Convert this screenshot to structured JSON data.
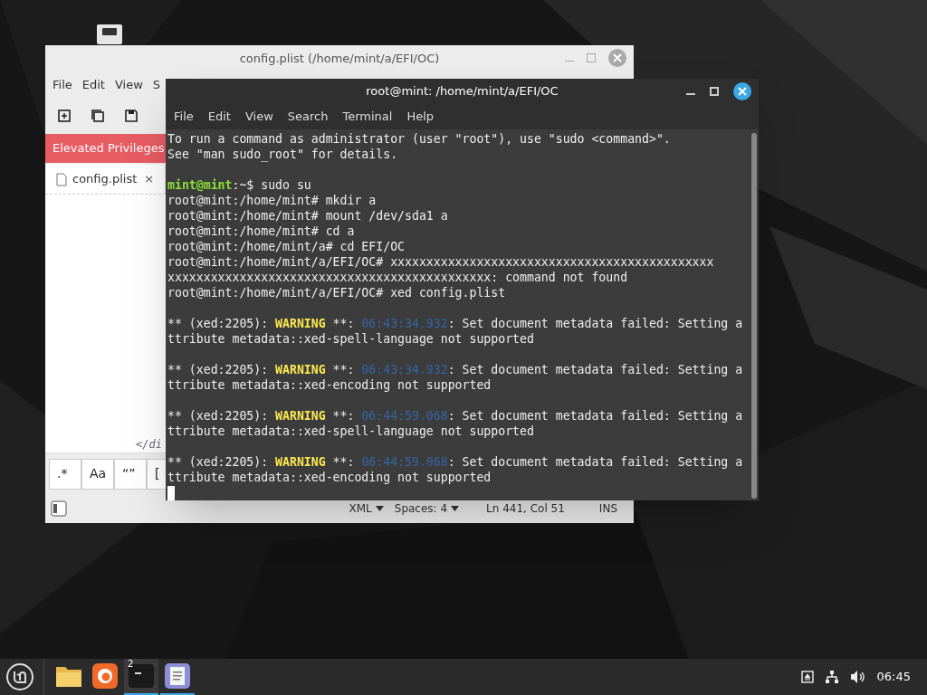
{
  "editor": {
    "title": "config.plist (/home/mint/a/EFI/OC)",
    "menu": [
      "File",
      "Edit",
      "View",
      "S"
    ],
    "infobar": "Elevated Privileges",
    "tab": {
      "label": "config.plist",
      "close": "×"
    },
    "content_fragment": "</di",
    "search_buttons": [
      ".*",
      "Aa",
      "“”",
      "["
    ],
    "status_bar": {
      "language": "XML",
      "spaces": "Spaces: 4",
      "position": "Ln 441, Col 51",
      "mode": "INS"
    }
  },
  "terminal": {
    "title": "root@mint: /home/mint/a/EFI/OC",
    "menu": [
      "File",
      "Edit",
      "View",
      "Search",
      "Terminal",
      "Help"
    ],
    "lines": [
      {
        "kind": "text",
        "text": "To run a command as administrator (user \"root\"), use \"sudo <command>\"."
      },
      {
        "kind": "text",
        "text": "See \"man sudo_root\" for details."
      },
      {
        "kind": "blank"
      },
      {
        "kind": "prompt",
        "user": "mint@mint",
        "rest": ":~$ sudo su"
      },
      {
        "kind": "text",
        "text": "root@mint:/home/mint# mkdir a"
      },
      {
        "kind": "text",
        "text": "root@mint:/home/mint# mount /dev/sda1 a"
      },
      {
        "kind": "text",
        "text": "root@mint:/home/mint# cd a"
      },
      {
        "kind": "text",
        "text": "root@mint:/home/mint/a# cd EFI/OC"
      },
      {
        "kind": "text",
        "text": "root@mint:/home/mint/a/EFI/OC# xxxxxxxxxxxxxxxxxxxxxxxxxxxxxxxxxxxxxxxxxxxxx"
      },
      {
        "kind": "text",
        "text": "xxxxxxxxxxxxxxxxxxxxxxxxxxxxxxxxxxxxxxxxxxxxx: command not found"
      },
      {
        "kind": "text",
        "text": "root@mint:/home/mint/a/EFI/OC# xed config.plist"
      },
      {
        "kind": "blank"
      },
      {
        "kind": "warning",
        "prefix": "** (xed:2205): ",
        "level": "WARNING",
        "mid": " **: ",
        "time": "06:43:34.932",
        "rest": ": Set document metadata failed: Setting a"
      },
      {
        "kind": "text",
        "text": "ttribute metadata::xed-spell-language not supported"
      },
      {
        "kind": "blank"
      },
      {
        "kind": "warning",
        "prefix": "** (xed:2205): ",
        "level": "WARNING",
        "mid": " **: ",
        "time": "06:43:34.932",
        "rest": ": Set document metadata failed: Setting a"
      },
      {
        "kind": "text",
        "text": "ttribute metadata::xed-encoding not supported"
      },
      {
        "kind": "blank"
      },
      {
        "kind": "warning",
        "prefix": "** (xed:2205): ",
        "level": "WARNING",
        "mid": " **: ",
        "time": "06:44:59.068",
        "rest": ": Set document metadata failed: Setting a"
      },
      {
        "kind": "text",
        "text": "ttribute metadata::xed-spell-language not supported"
      },
      {
        "kind": "blank"
      },
      {
        "kind": "warning",
        "prefix": "** (xed:2205): ",
        "level": "WARNING",
        "mid": " **: ",
        "time": "06:44:59.068",
        "rest": ": Set document metadata failed: Setting a"
      },
      {
        "kind": "text",
        "text": "ttribute metadata::xed-encoding not supported"
      },
      {
        "kind": "cursor"
      }
    ]
  },
  "taskbar": {
    "apps": [
      {
        "kind": "folder",
        "active": false
      },
      {
        "kind": "browser",
        "active": false
      },
      {
        "kind": "terminal",
        "active": true,
        "badge": "2"
      },
      {
        "kind": "editor",
        "active": true
      }
    ],
    "clock": "06:45"
  }
}
